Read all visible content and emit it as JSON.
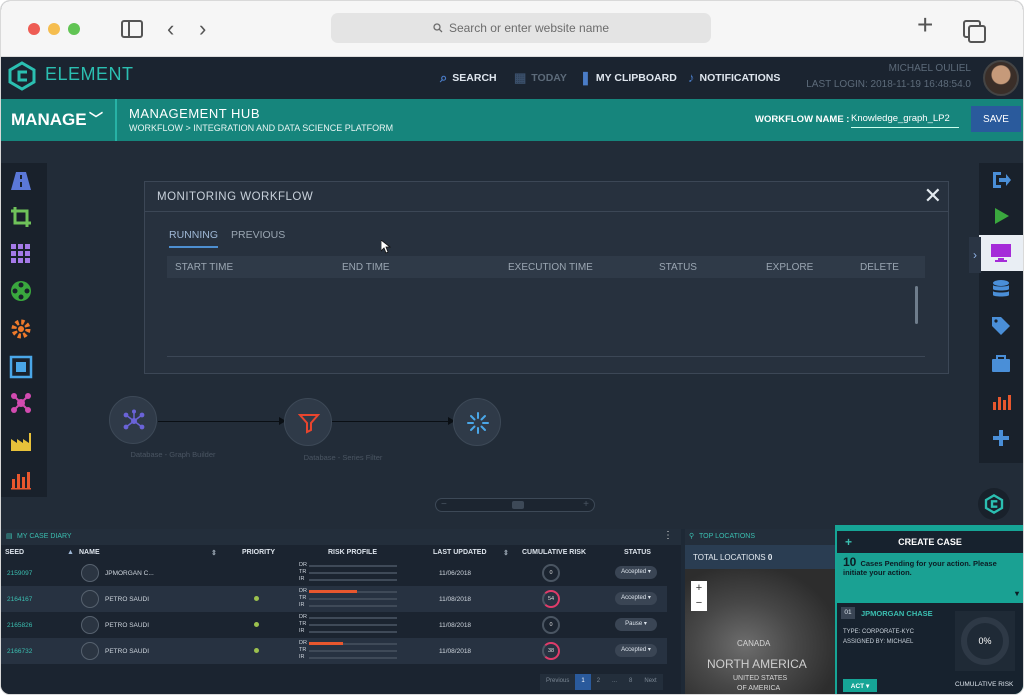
{
  "browser": {
    "url_placeholder": "Search or enter website name"
  },
  "header": {
    "brand": "ELEMENT",
    "nav": [
      {
        "label": "SEARCH",
        "icon": "search-icon"
      },
      {
        "label": "TODAY",
        "icon": "calendar-icon"
      },
      {
        "label": "MY CLIPBOARD",
        "icon": "bookmark-icon"
      },
      {
        "label": "NOTIFICATIONS",
        "icon": "bell-icon"
      }
    ],
    "user_name": "MICHAEL OULIEL",
    "last_login": "LAST LOGIN: 2018-11-19 16:48:54.0"
  },
  "toolbar": {
    "manage": "MANAGE",
    "title": "MANAGEMENT HUB",
    "breadcrumb": "WORKFLOW > INTEGRATION AND DATA SCIENCE PLATFORM",
    "workflow_label": "WORKFLOW NAME :",
    "workflow_value": "Knowledge_graph_LP2",
    "save": "SAVE"
  },
  "modal": {
    "title": "MONITORING WORKFLOW",
    "tabs": [
      "RUNNING",
      "PREVIOUS"
    ],
    "columns": [
      "START TIME",
      "END TIME",
      "EXECUTION TIME",
      "STATUS",
      "EXPLORE",
      "DELETE"
    ]
  },
  "workflow": {
    "nodes": [
      "Database - Graph Builder",
      "Database - Series Filter",
      ""
    ]
  },
  "diary": {
    "title": "MY CASE DIARY",
    "columns": [
      "SEED",
      "NAME",
      "PRIORITY",
      "RISK PROFILE",
      "LAST UPDATED",
      "CUMULATIVE RISK",
      "STATUS"
    ],
    "risk_labels": [
      "DR",
      "TR",
      "IR"
    ],
    "rows": [
      {
        "seed": "2159097",
        "name": "JPMORGAN C...",
        "updated": "11/06/2018",
        "risk": "0",
        "status": "Accepted ▾",
        "dr": 0,
        "priority": false
      },
      {
        "seed": "2164167",
        "name": "PETRO SAUDI",
        "updated": "11/08/2018",
        "risk": "54",
        "status": "Accepted ▾",
        "dr": 0.55,
        "priority": true
      },
      {
        "seed": "2165826",
        "name": "PETRO SAUDI",
        "updated": "11/08/2018",
        "risk": "0",
        "status": "Pause ▾",
        "dr": 0,
        "priority": true
      },
      {
        "seed": "2166732",
        "name": "PETRO SAUDI",
        "updated": "11/08/2018",
        "risk": "38",
        "status": "Accepted ▾",
        "dr": 0.38,
        "priority": true
      }
    ],
    "pager": [
      "Previous",
      "1",
      "2",
      "...",
      "8",
      "Next"
    ]
  },
  "locations": {
    "title": "TOP LOCATIONS",
    "total_label": "TOTAL LOCATIONS",
    "total_value": "0",
    "map_labels": [
      "CANADA",
      "NORTH AMERICA",
      "UNITED STATES",
      "OF AMERICA"
    ]
  },
  "case": {
    "title": "CREATE CASE",
    "pending_count": "10",
    "pending_text": "Cases Pending for your action. Please initiate your action.",
    "number": "01",
    "name": "JPMORGAN CHASE",
    "type": "TYPE: CORPORATE-KYC",
    "assigned": "ASSIGNED BY: MICHAEL",
    "gauge": "0%",
    "act": "ACT ▾",
    "cumulative": "CUMULATIVE RISK"
  },
  "colors": {
    "accent": "#16a596",
    "brand_teal": "#2bbfb1",
    "primary_blue": "#2a5a9c",
    "risk_orange": "#e8572e"
  }
}
